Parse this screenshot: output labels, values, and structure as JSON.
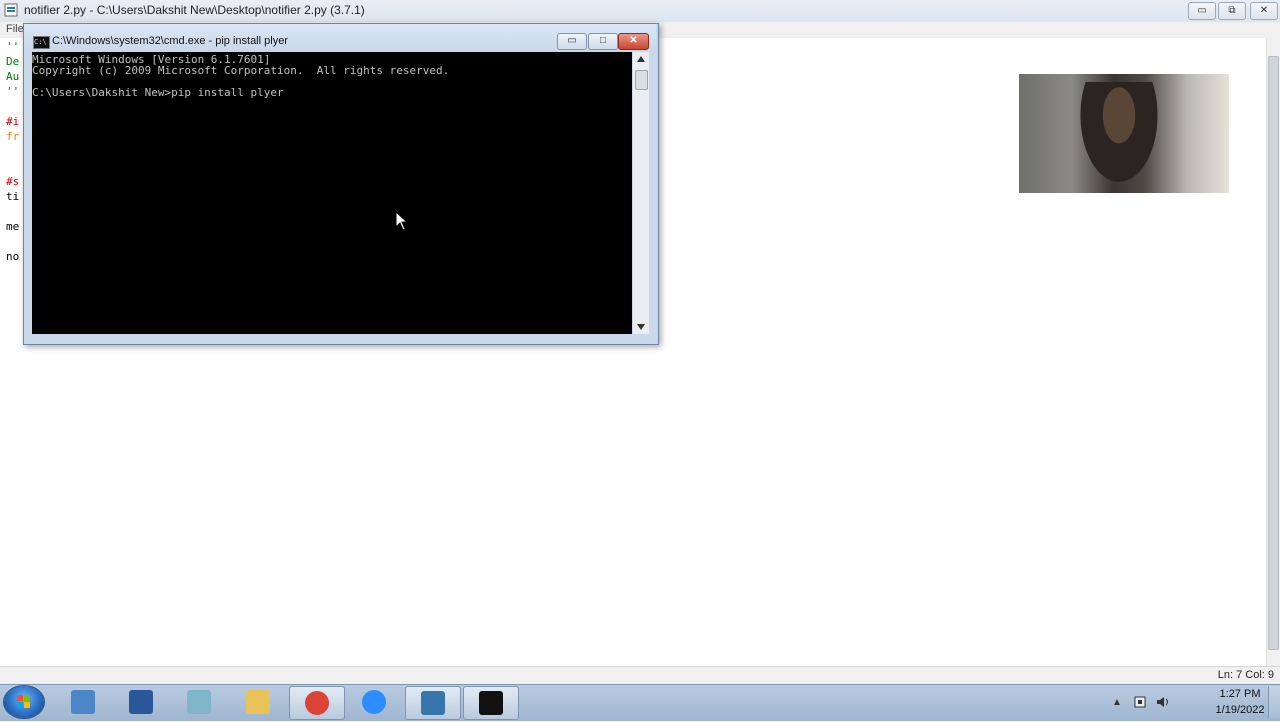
{
  "idle": {
    "title": "notifier 2.py - C:\\Users\\Dakshit New\\Desktop\\notifier 2.py (3.7.1)",
    "menu_file": "File",
    "code_lines": [
      {
        "text": "''",
        "color": "#008000"
      },
      {
        "text": "De",
        "color": "#008000"
      },
      {
        "text": "Au",
        "color": "#008000"
      },
      {
        "text": "''",
        "color": "#008000"
      },
      {
        "text": "",
        "color": "#000000"
      },
      {
        "text": "#i",
        "color": "#dd0000"
      },
      {
        "text": "fr",
        "color": "#ff7700"
      },
      {
        "text": "",
        "color": "#000000"
      },
      {
        "text": "",
        "color": "#000000"
      },
      {
        "text": "#s",
        "color": "#dd0000"
      },
      {
        "text": "ti",
        "color": "#000000"
      },
      {
        "text": "",
        "color": "#000000"
      },
      {
        "text": "me",
        "color": "#000000"
      },
      {
        "text": "",
        "color": "#000000"
      },
      {
        "text": "no",
        "color": "#000000"
      }
    ],
    "status": "Ln: 7   Col: 9",
    "window_buttons": {
      "minimize": "▭",
      "restore": "⧉",
      "close": "✕"
    }
  },
  "cmd": {
    "title": "C:\\Windows\\system32\\cmd.exe - pip  install plyer",
    "icon_text": "C:\\",
    "lines": [
      "Microsoft Windows [Version 6.1.7601]",
      "Copyright (c) 2009 Microsoft Corporation.  All rights reserved.",
      "",
      "C:\\Users\\Dakshit New>pip install plyer"
    ],
    "buttons": {
      "minimize": "▭",
      "maximize": "□",
      "close": "✕"
    }
  },
  "taskbar": {
    "time": "1:27 PM",
    "date": "1/19/2022",
    "apps": [
      {
        "name": "calculator",
        "color": "#4a86c8"
      },
      {
        "name": "word",
        "color": "#2b579a"
      },
      {
        "name": "notes",
        "color": "#7fb6c9"
      },
      {
        "name": "explorer",
        "color": "#e8c35a"
      },
      {
        "name": "chrome",
        "color": "#db4437"
      },
      {
        "name": "zoom",
        "color": "#2d8cff"
      },
      {
        "name": "python",
        "color": "#3776ab"
      },
      {
        "name": "cmd",
        "color": "#111111"
      }
    ]
  }
}
